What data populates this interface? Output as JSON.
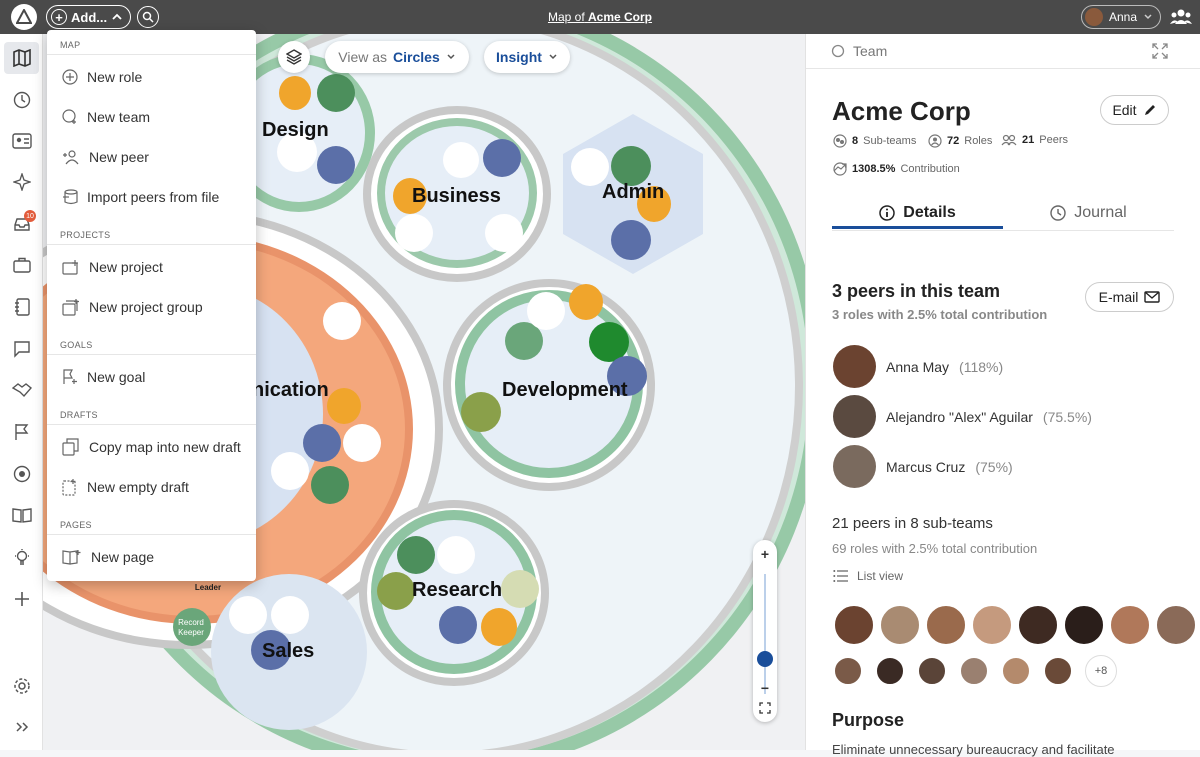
{
  "topbar": {
    "add_label": "Add...",
    "map_prefix": "Map of",
    "map_name": "Acme Corp",
    "user_name": "Anna"
  },
  "sidebar": {
    "notification_count": "10"
  },
  "canvas": {
    "view_as_label": "View as",
    "view_as_value": "Circles",
    "insight_label": "Insight",
    "teams": {
      "design": "Design",
      "business": "Business",
      "admin": "Admin",
      "communication": "nication",
      "development": "Development",
      "research": "Research",
      "sales": "Sales"
    },
    "roles": {
      "team_leader": "Team Leader",
      "record_keeper": "Record Keeper"
    }
  },
  "menu": {
    "sections": {
      "map": "MAP",
      "projects": "PROJECTS",
      "goals": "GOALS",
      "drafts": "DRAFTS",
      "pages": "PAGES"
    },
    "items": {
      "new_role": "New role",
      "new_team": "New team",
      "new_peer": "New peer",
      "import_peers": "Import peers from file",
      "new_project": "New project",
      "new_project_group": "New project group",
      "new_goal": "New goal",
      "copy_map": "Copy map into new draft",
      "new_empty_draft": "New empty draft",
      "new_page": "New page"
    }
  },
  "panel": {
    "type_label": "Team",
    "title": "Acme Corp",
    "edit_label": "Edit",
    "stats": {
      "subteams_count": "8",
      "subteams_label": "Sub-teams",
      "roles_count": "72",
      "roles_label": "Roles",
      "peers_count": "21",
      "peers_label": "Peers",
      "contribution_value": "1308.5%",
      "contribution_label": "Contribution"
    },
    "tabs": {
      "details": "Details",
      "journal": "Journal"
    },
    "peers_heading": "3 peers in this team",
    "peers_sub": "3 roles with 2.5% total contribution",
    "email_label": "E-mail",
    "peers": [
      {
        "name": "Anna May",
        "pct": "(118%)"
      },
      {
        "name": "Alejandro \"Alex\" Aguilar",
        "pct": "(75.5%)"
      },
      {
        "name": "Marcus Cruz",
        "pct": "(75%)"
      }
    ],
    "subteam_heading": "21 peers in 8 sub-teams",
    "subteam_sub": "69 roles with 2.5% total contribution",
    "list_view_label": "List view",
    "more_count": "+8",
    "purpose_heading": "Purpose",
    "purpose_text": "Eliminate unnecessary bureaucracy and facilitate"
  }
}
